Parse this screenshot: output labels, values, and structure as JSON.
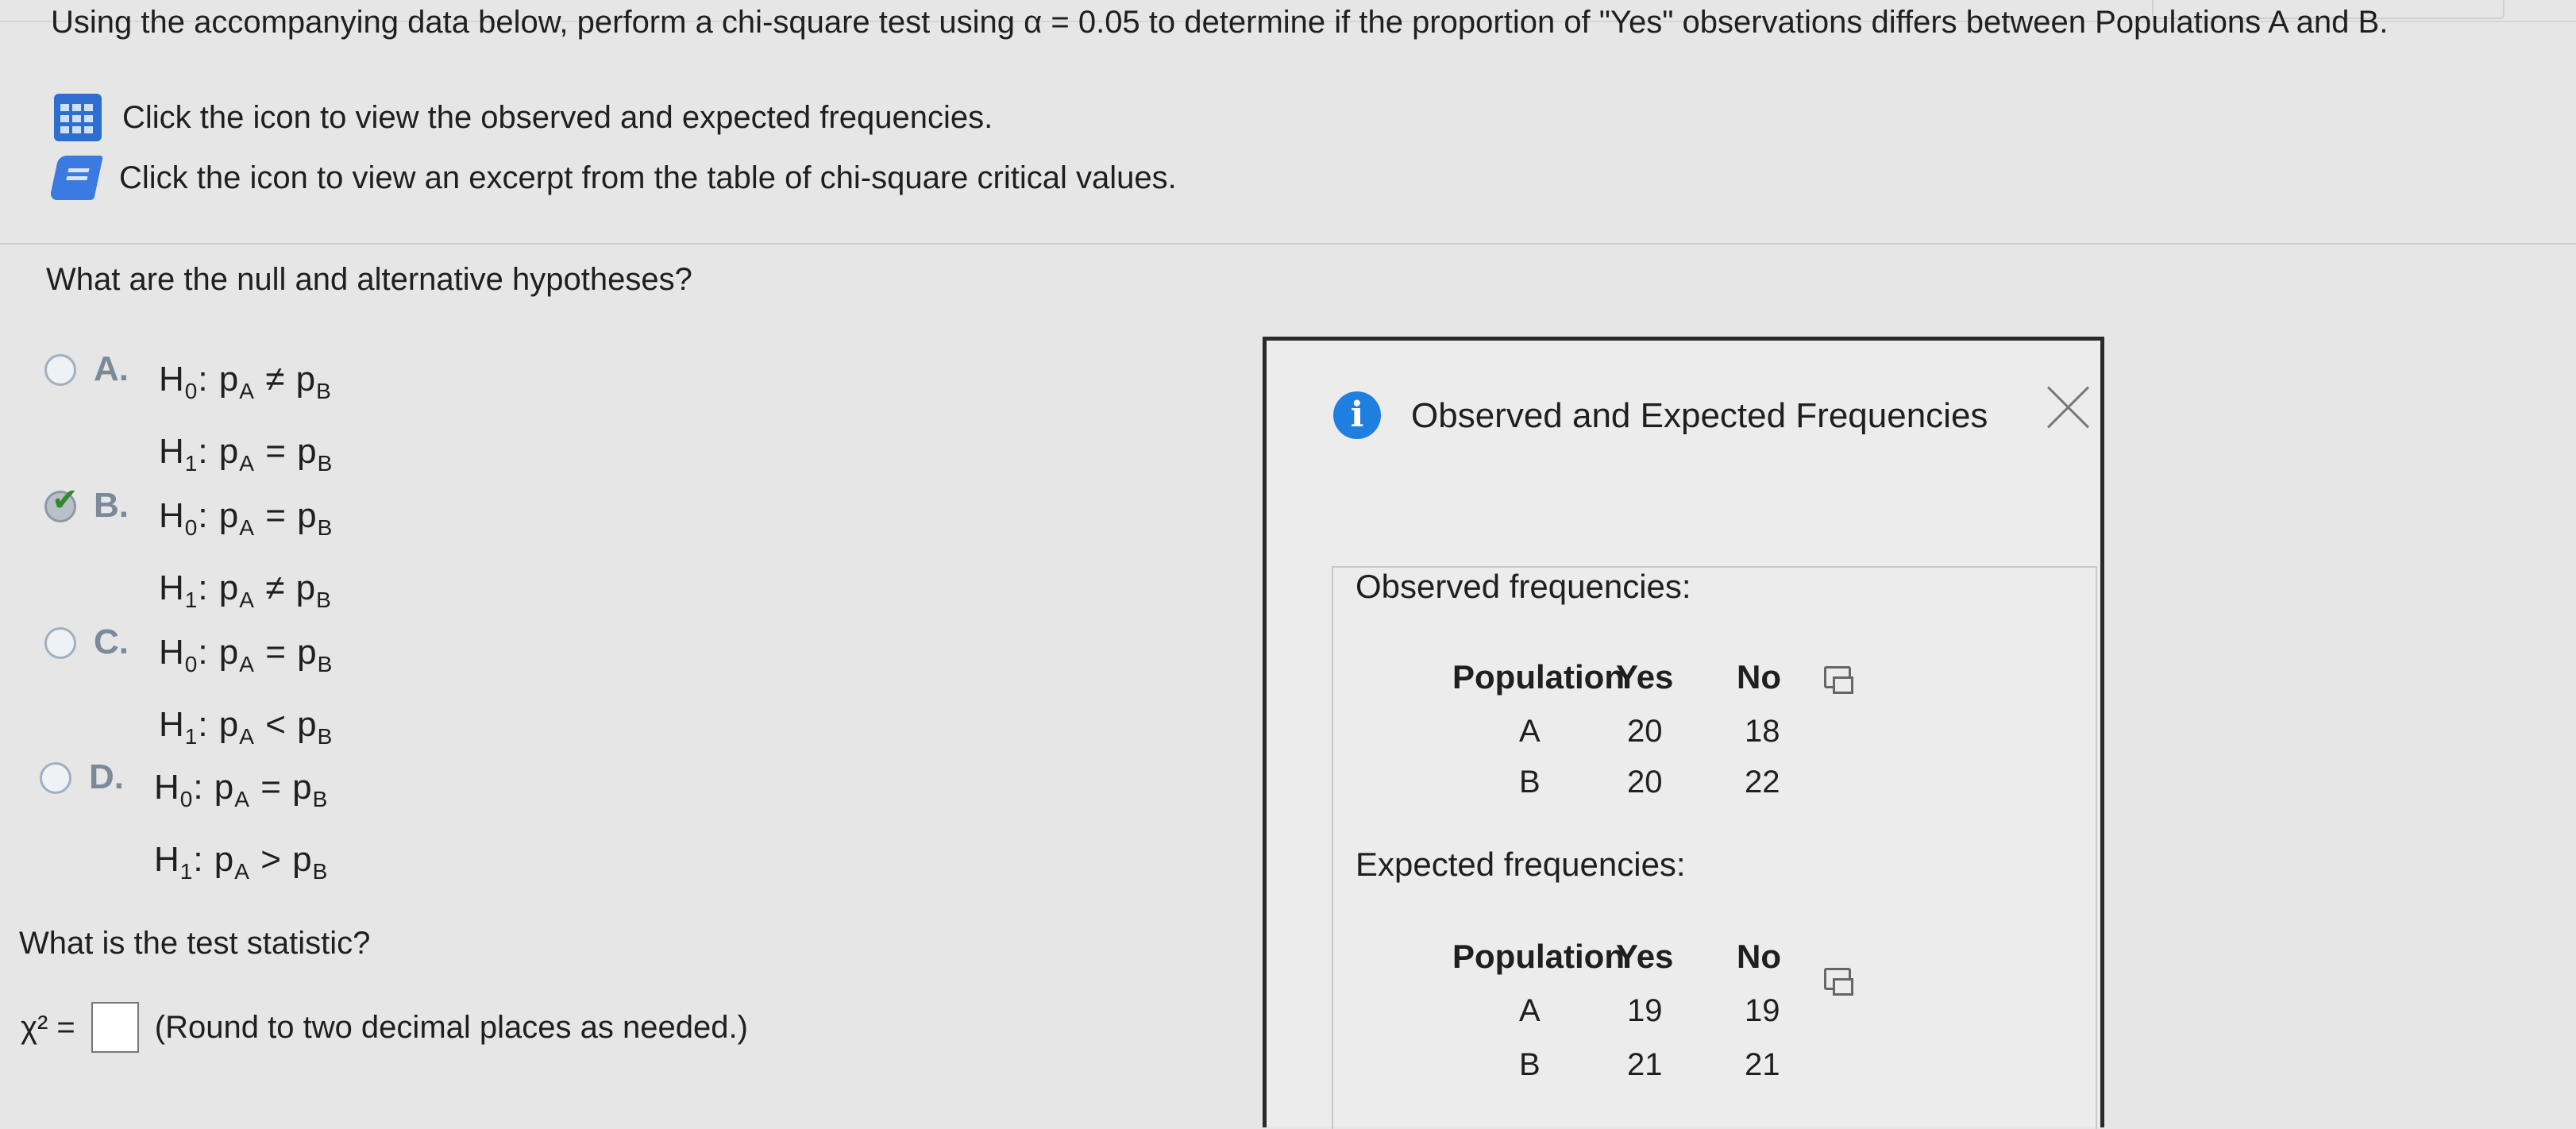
{
  "question": {
    "prompt": "Using the accompanying data below, perform a chi-square test using α = 0.05 to determine if the proportion of \"Yes\" observations differs between Populations A and B."
  },
  "links": [
    {
      "icon": "data-table-icon",
      "text": "Click the icon to view the observed and expected frequencies."
    },
    {
      "icon": "book-icon",
      "text": "Click the icon to view an excerpt from the table of chi-square critical values."
    }
  ],
  "hypotheses": {
    "question": "What are the null and alternative hypotheses?",
    "choices": [
      {
        "letter": "A.",
        "h0": "pₐ ≠ pᵦ",
        "h0_rel": "≠",
        "h1_rel": "=",
        "selected": false
      },
      {
        "letter": "B.",
        "h0_rel": "=",
        "h1_rel": "≠",
        "selected": true
      },
      {
        "letter": "C.",
        "h0_rel": "=",
        "h1_rel": "<",
        "selected": false
      },
      {
        "letter": "D.",
        "h0_rel": "=",
        "h1_rel": ">",
        "selected": false
      }
    ]
  },
  "test_statistic": {
    "question": "What is the test statistic?",
    "symbol": "χ² =",
    "value": "",
    "hint": "(Round to two decimal places as needed.)"
  },
  "dialog": {
    "title": "Observed and Expected Frequencies",
    "observed": {
      "label": "Observed frequencies:",
      "headers": [
        "Population",
        "Yes",
        "No"
      ],
      "rows": [
        [
          "A",
          "20",
          "18"
        ],
        [
          "B",
          "20",
          "22"
        ]
      ]
    },
    "expected": {
      "label": "Expected frequencies:",
      "headers": [
        "Population",
        "Yes",
        "No"
      ],
      "rows": [
        [
          "A",
          "19",
          "19"
        ],
        [
          "B",
          "21",
          "21"
        ]
      ]
    }
  },
  "colors": {
    "accent": "#1f7fe0",
    "check": "#2f8a2f",
    "letter": "#7b8a99"
  }
}
